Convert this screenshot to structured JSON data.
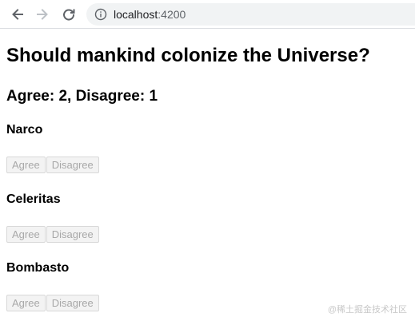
{
  "browser": {
    "url_host": "localhost",
    "url_port": ":4200"
  },
  "page": {
    "title": "Should mankind colonize the Universe?",
    "tally": "Agree: 2, Disagree: 1",
    "voters": [
      {
        "name": "Narco",
        "agree_label": "Agree",
        "disagree_label": "Disagree"
      },
      {
        "name": "Celeritas",
        "agree_label": "Agree",
        "disagree_label": "Disagree"
      },
      {
        "name": "Bombasto",
        "agree_label": "Agree",
        "disagree_label": "Disagree"
      }
    ]
  },
  "watermark": "@稀土掘金技术社区",
  "icons": {
    "back": "back-arrow-icon",
    "forward": "forward-arrow-icon",
    "reload": "reload-icon",
    "info": "info-icon"
  }
}
